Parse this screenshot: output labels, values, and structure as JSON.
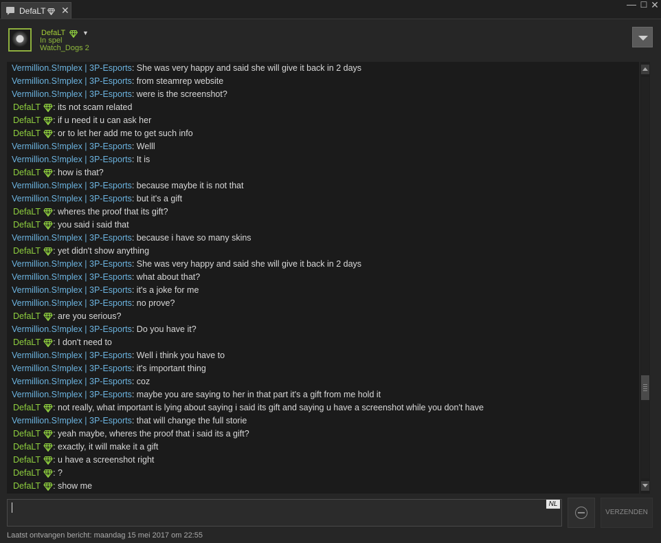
{
  "window": {
    "tab_title": "DefaLT",
    "controls": {
      "minimize": "—",
      "maximize": "☐",
      "close": "✕"
    }
  },
  "header": {
    "name": "DefaLT",
    "status": "In spel",
    "game": "Watch_Dogs 2"
  },
  "colors": {
    "friend_name": "#8fcf3f",
    "other_name": "#6cb4e0",
    "message_text": "#d8d8d8",
    "gem": "#8fcf3f",
    "background": "#1b1b1b"
  },
  "messages": [
    {
      "sender": "Vermillion.S!mplex | 3P-Esports",
      "text": "She was very happy and said she will give it back in 2 days"
    },
    {
      "sender": "Vermillion.S!mplex | 3P-Esports",
      "text": "from steamrep website"
    },
    {
      "sender": "Vermillion.S!mplex | 3P-Esports",
      "text": "were is the screenshot?"
    },
    {
      "sender": "DefaLT",
      "text": "its not scam related"
    },
    {
      "sender": "DefaLT",
      "text": "if u need it u can ask her"
    },
    {
      "sender": "DefaLT",
      "text": "or to let her add me to get such info"
    },
    {
      "sender": "Vermillion.S!mplex | 3P-Esports",
      "text": "Welll"
    },
    {
      "sender": "Vermillion.S!mplex | 3P-Esports",
      "text": "It is"
    },
    {
      "sender": "DefaLT",
      "text": "how is that?"
    },
    {
      "sender": "Vermillion.S!mplex | 3P-Esports",
      "text": "because maybe it is not that"
    },
    {
      "sender": "Vermillion.S!mplex | 3P-Esports",
      "text": "but it's a gift"
    },
    {
      "sender": "DefaLT",
      "text": "wheres the proof that its gift?"
    },
    {
      "sender": "DefaLT",
      "text": "you said i said that"
    },
    {
      "sender": "Vermillion.S!mplex | 3P-Esports",
      "text": "because i have so many skins"
    },
    {
      "sender": "DefaLT",
      "text": "yet didn't show anything"
    },
    {
      "sender": "Vermillion.S!mplex | 3P-Esports",
      "text": "She was very happy and said she will give it back in 2 days"
    },
    {
      "sender": "Vermillion.S!mplex | 3P-Esports",
      "text": "what about that?"
    },
    {
      "sender": "Vermillion.S!mplex | 3P-Esports",
      "text": "it's a joke for me"
    },
    {
      "sender": "Vermillion.S!mplex | 3P-Esports",
      "text": "no prove?"
    },
    {
      "sender": "DefaLT",
      "text": "are you serious?"
    },
    {
      "sender": "Vermillion.S!mplex | 3P-Esports",
      "text": "Do you have it?"
    },
    {
      "sender": "DefaLT",
      "text": "I don't need to"
    },
    {
      "sender": "Vermillion.S!mplex | 3P-Esports",
      "text": "Well i think you have to"
    },
    {
      "sender": "Vermillion.S!mplex | 3P-Esports",
      "text": "it's important thing"
    },
    {
      "sender": "Vermillion.S!mplex | 3P-Esports",
      "text": "coz"
    },
    {
      "sender": "Vermillion.S!mplex | 3P-Esports",
      "text": "maybe you are saying to her in that part it's a gift from me hold it"
    },
    {
      "sender": "DefaLT",
      "text": "not really, what important is lying about saying i said its gift and saying u have a screenshot while you don't have"
    },
    {
      "sender": "Vermillion.S!mplex | 3P-Esports",
      "text": "that will change the full storie"
    },
    {
      "sender": "DefaLT",
      "text": "yeah maybe, wheres the proof that i said its a gift?"
    },
    {
      "sender": "DefaLT",
      "text": "exactly, it will make it a gift"
    },
    {
      "sender": "DefaLT",
      "text": "u have a screenshot right"
    },
    {
      "sender": "DefaLT",
      "text": "?"
    },
    {
      "sender": "DefaLT",
      "text": "show me"
    }
  ],
  "composer": {
    "value": "",
    "language_badge": "NL",
    "send_label": "VERZENDEN"
  },
  "footer": {
    "last_received": "Laatst ontvangen bericht: maandag 15 mei 2017 om 22:55"
  }
}
